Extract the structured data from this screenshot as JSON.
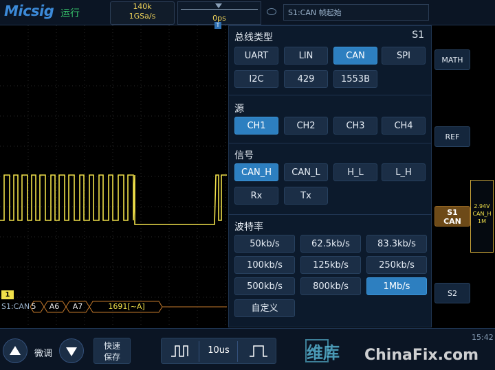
{
  "header": {
    "brand": "Micsig",
    "run_state": "运行",
    "memory_depth": "140k",
    "sample_rate": "1GSa/s",
    "trigger_time": "0ps",
    "trigger_desc": "S1:CAN 帧起始"
  },
  "scope": {
    "trigger_marker": "T",
    "ch1_label": "1",
    "bus_label": "S1:CAN",
    "bus_segments": [
      "5",
      "A6",
      "A7",
      "1691[~A]"
    ]
  },
  "panel": {
    "bus_type": {
      "title": "总线类型",
      "slot": "S1",
      "options": [
        "UART",
        "LIN",
        "CAN",
        "SPI",
        "I2C",
        "429",
        "1553B"
      ],
      "selected": "CAN"
    },
    "source": {
      "title": "源",
      "options": [
        "CH1",
        "CH2",
        "CH3",
        "CH4"
      ],
      "selected": "CH1"
    },
    "signal": {
      "title": "信号",
      "options": [
        "CAN_H",
        "CAN_L",
        "H_L",
        "L_H",
        "Rx",
        "Tx"
      ],
      "selected": "CAN_H"
    },
    "baud": {
      "title": "波特率",
      "options": [
        "50kb/s",
        "62.5kb/s",
        "83.3kb/s",
        "100kb/s",
        "125kb/s",
        "250kb/s",
        "500kb/s",
        "800kb/s",
        "1Mb/s",
        "自定义"
      ],
      "selected": "1Mb/s"
    }
  },
  "right": {
    "math": "MATH",
    "ref": "REF",
    "s1_line1": "S1",
    "s1_line2": "CAN",
    "s2": "S2",
    "ch_info": [
      "2.94V",
      "CAN_H",
      "1M"
    ]
  },
  "footer": {
    "fine": "微调",
    "save_line1": "快速",
    "save_line2": "保存",
    "timebase": "10us",
    "clock": "15:42",
    "watermark_cn": "维库",
    "watermark_en": "ChinaFix.com"
  },
  "colors": {
    "trace": "#f0e04a",
    "selected": "#2d7fc0",
    "panel_bg": "#0c1a2c"
  }
}
